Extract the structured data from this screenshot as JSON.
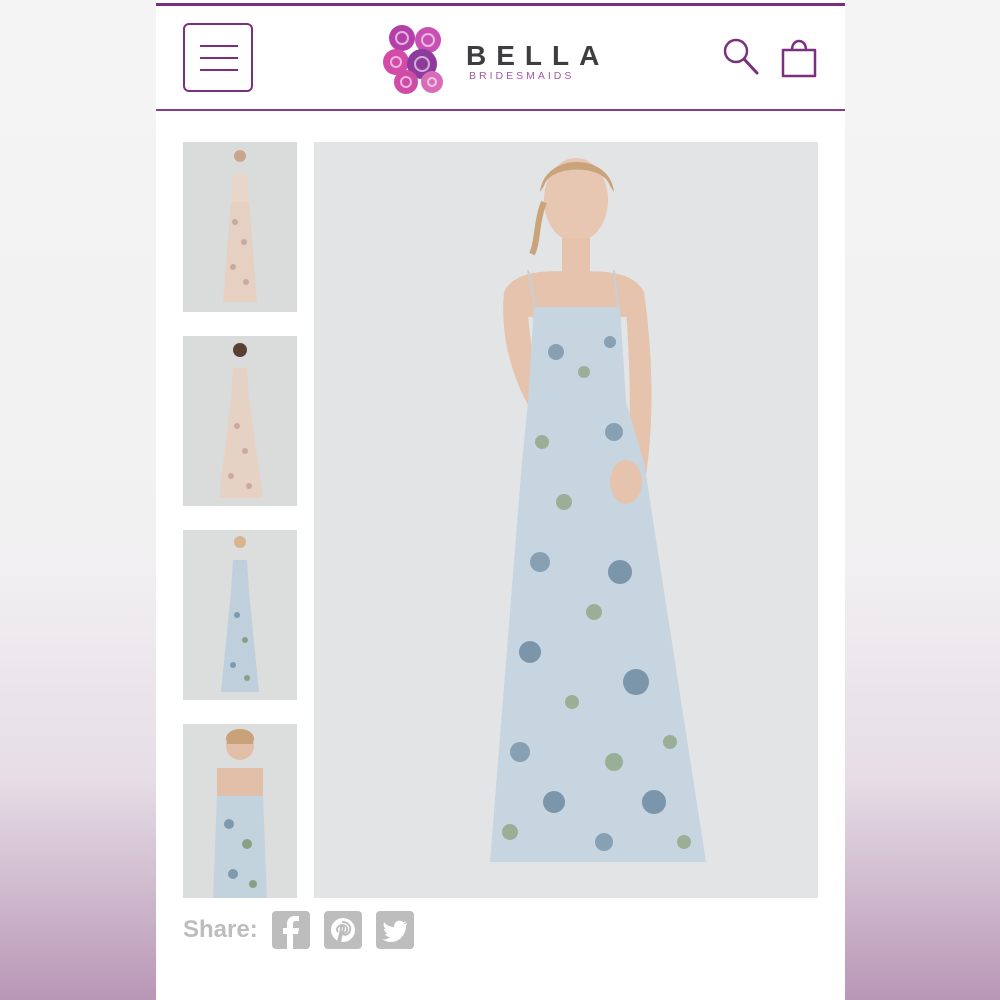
{
  "brand": {
    "name": "BELLA",
    "tagline": "BRIDESMAIDS",
    "colors": {
      "accent": "#7b2f80",
      "logo_pink": "#d63fa0",
      "logo_purple": "#8e3b9e"
    }
  },
  "header": {
    "menu_icon": "hamburger-menu-icon",
    "search_icon": "search-icon",
    "bag_icon": "shopping-bag-icon"
  },
  "gallery": {
    "thumbnails": [
      {
        "name": "thumb-blush-front",
        "dress_color": "#e9d6c9"
      },
      {
        "name": "thumb-blush-back",
        "dress_color": "#e6d2c4"
      },
      {
        "name": "thumb-blue-front",
        "dress_color": "#bfd0dc"
      },
      {
        "name": "thumb-blue-closeup",
        "dress_color": "#c3d3de"
      }
    ],
    "main_dress_color": "#c6d5df"
  },
  "share": {
    "label": "Share:",
    "icons": [
      "facebook-icon",
      "pinterest-icon",
      "twitter-icon"
    ],
    "icon_color": "#bdbdbd"
  }
}
